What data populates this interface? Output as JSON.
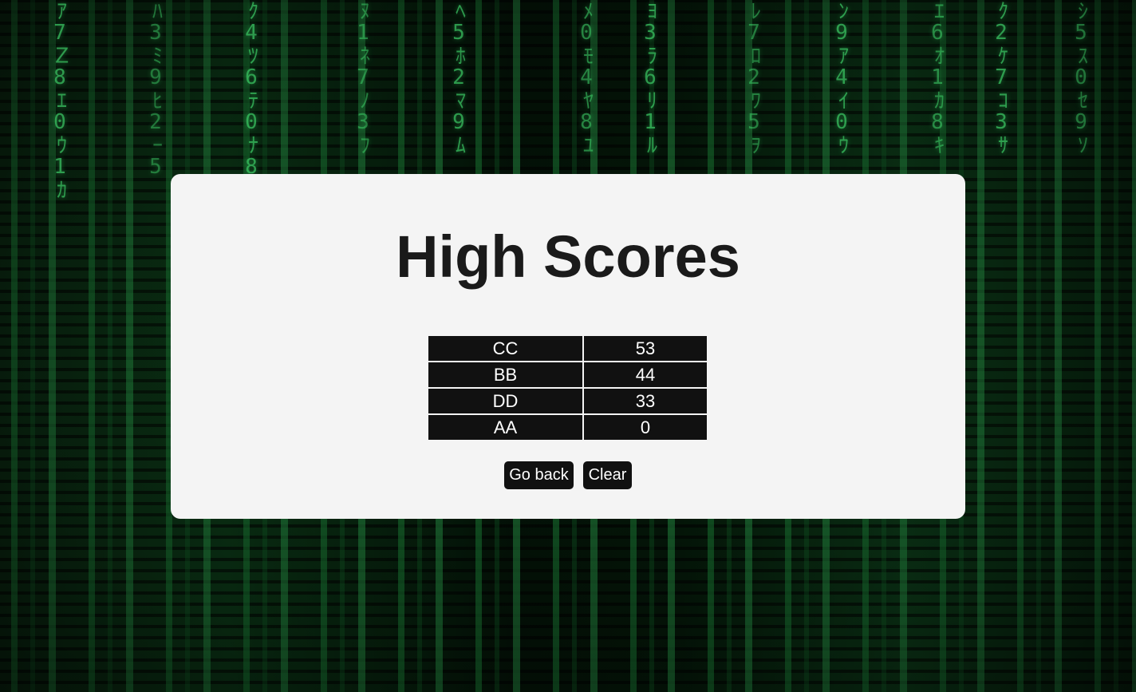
{
  "page": {
    "title": "High Scores"
  },
  "scores": [
    {
      "initials": "CC",
      "score": "53"
    },
    {
      "initials": "BB",
      "score": "44"
    },
    {
      "initials": "DD",
      "score": "33"
    },
    {
      "initials": "AA",
      "score": "0"
    }
  ],
  "buttons": {
    "go_back": "Go back",
    "clear": "Clear"
  },
  "colors": {
    "card_background": "#f4f4f4",
    "table_cell": "#111111",
    "button": "#111111",
    "matrix_green": "#3fd46a"
  }
}
